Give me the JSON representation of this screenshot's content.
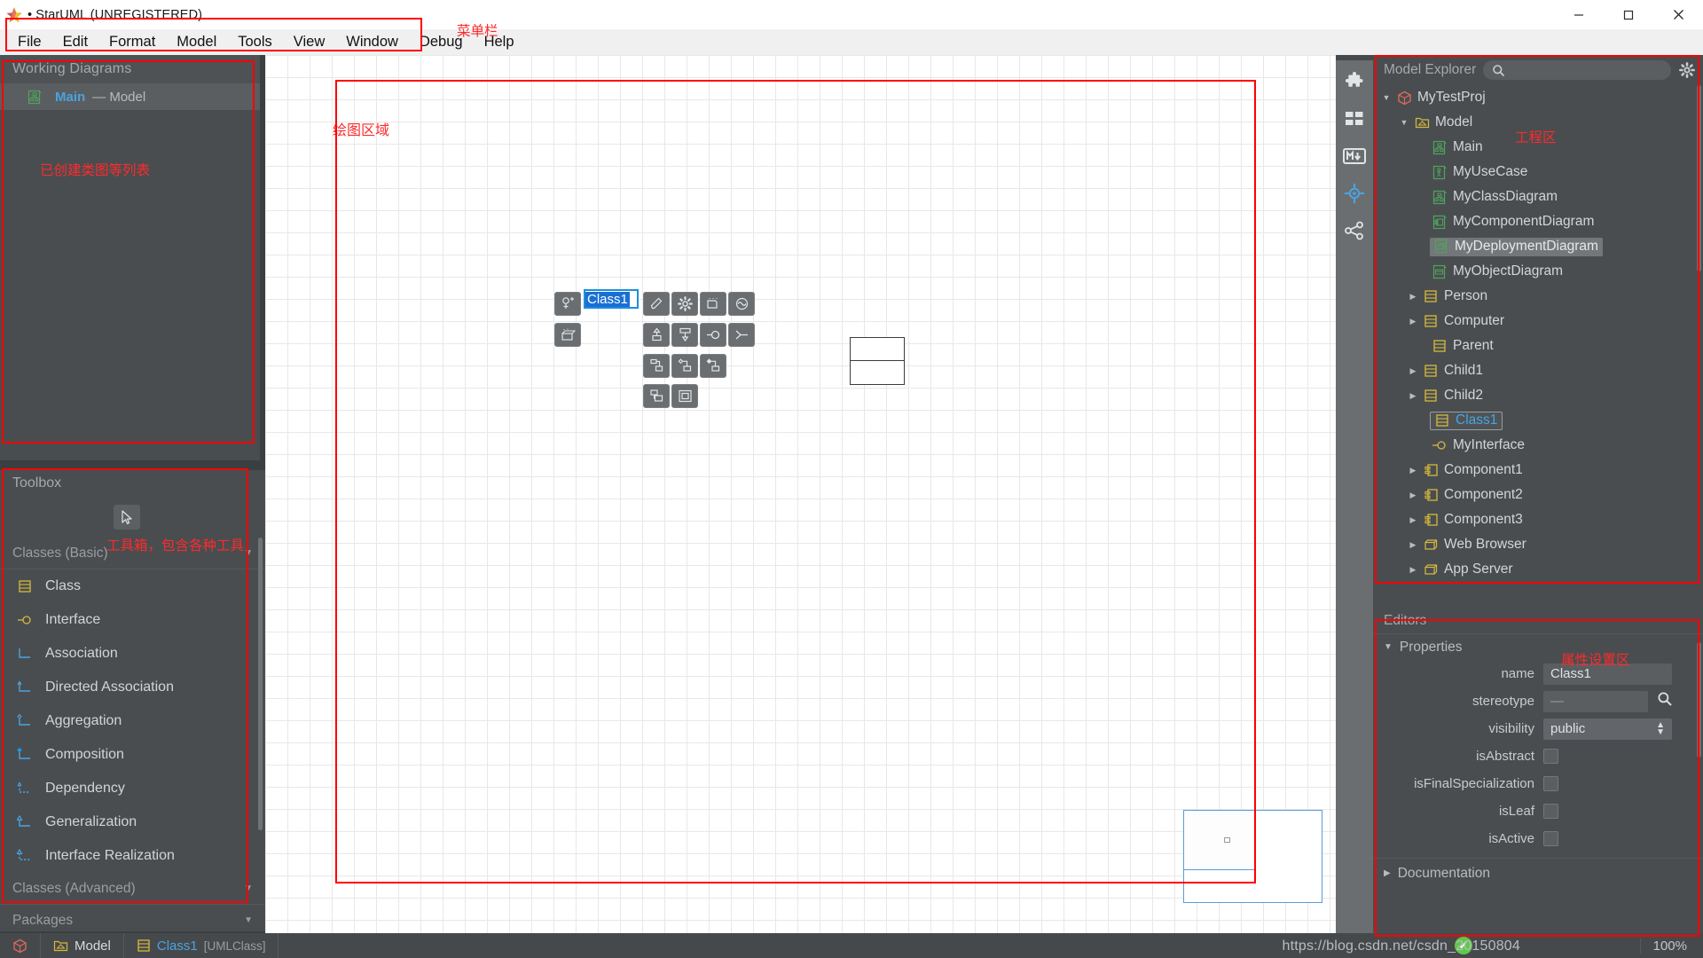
{
  "window": {
    "title": "• StarUML (UNREGISTERED)",
    "minimize_label": "–",
    "maximize_label": "□",
    "close_label": "✕"
  },
  "menubar": {
    "items": [
      "File",
      "Edit",
      "Format",
      "Model",
      "Tools",
      "View",
      "Window",
      "Debug",
      "Help"
    ],
    "annotation": "菜单栏"
  },
  "working_diagrams": {
    "title": "Working Diagrams",
    "annotation": "已创建类图等列表",
    "items": [
      {
        "name": "Main",
        "suffix": "— Model",
        "icon": "class-diagram-icon"
      }
    ]
  },
  "toolbox": {
    "title": "Toolbox",
    "annotation": "工具箱，包含各种工具",
    "cursor_tool": "select-pointer-icon",
    "sections": [
      {
        "label": "Classes (Basic)",
        "collapsed": false,
        "items": [
          {
            "label": "Class",
            "icon": "class-icon"
          },
          {
            "label": "Interface",
            "icon": "interface-icon"
          },
          {
            "label": "Association",
            "icon": "association-icon"
          },
          {
            "label": "Directed Association",
            "icon": "directed-association-icon"
          },
          {
            "label": "Aggregation",
            "icon": "aggregation-icon"
          },
          {
            "label": "Composition",
            "icon": "composition-icon"
          },
          {
            "label": "Dependency",
            "icon": "dependency-icon"
          },
          {
            "label": "Generalization",
            "icon": "generalization-icon"
          },
          {
            "label": "Interface Realization",
            "icon": "interface-realization-icon"
          }
        ]
      },
      {
        "label": "Classes (Advanced)",
        "collapsed": true,
        "items": []
      },
      {
        "label": "Packages",
        "collapsed": true,
        "items": []
      }
    ]
  },
  "canvas": {
    "annotation": "绘图区域",
    "class_shape": {
      "name": "Class1",
      "editing": true
    },
    "quick_edit": {
      "left_buttons": [
        {
          "name": "add-attribute-button",
          "icon": "attribute-plus-icon"
        },
        {
          "name": "add-operation-button",
          "icon": "operation-icon"
        }
      ],
      "right_buttons": [
        {
          "name": "style-button",
          "icon": "pencil-icon"
        },
        {
          "name": "properties-button",
          "icon": "gear-icon"
        },
        {
          "name": "add-note-button",
          "icon": "note-icon"
        },
        {
          "name": "add-state-button",
          "icon": "state-icon"
        },
        {
          "name": "generalization-button",
          "icon": "generalization-arrow-icon"
        },
        {
          "name": "realization-button",
          "icon": "realization-icon"
        },
        {
          "name": "interface-button",
          "icon": "lollipop-icon"
        },
        {
          "name": "dependency-button",
          "icon": "dependency-fork-icon"
        },
        {
          "name": "association-button",
          "icon": "association-line-icon"
        },
        {
          "name": "aggregation-button",
          "icon": "aggregation-diamond-icon"
        },
        {
          "name": "composition-button",
          "icon": "composition-diamond-icon"
        },
        {
          "name": "add-class-button",
          "icon": "class-box-icon"
        },
        {
          "name": "add-package-button",
          "icon": "package-box-icon"
        }
      ]
    }
  },
  "icon_rail": {
    "items": [
      {
        "name": "extensions-icon",
        "glyph": "puzzle"
      },
      {
        "name": "grid-layout-icon",
        "glyph": "grid"
      },
      {
        "name": "markdown-icon",
        "glyph": "MD"
      },
      {
        "name": "navigate-icon",
        "glyph": "target",
        "active": true
      },
      {
        "name": "relationships-icon",
        "glyph": "share"
      }
    ]
  },
  "model_explorer": {
    "title": "Model Explorer",
    "annotation": "工程区",
    "search_placeholder": "",
    "search_value": "",
    "tree": [
      {
        "label": "MyTestProj",
        "depth": 0,
        "icon": "project-icon",
        "twisty": "open",
        "state": "normal"
      },
      {
        "label": "Model",
        "depth": 1,
        "icon": "model-icon",
        "twisty": "open",
        "state": "normal"
      },
      {
        "label": "Main",
        "depth": 2,
        "icon": "class-diagram-icon",
        "twisty": "none",
        "state": "normal"
      },
      {
        "label": "MyUseCase",
        "depth": 2,
        "icon": "usecase-diagram-icon",
        "twisty": "none",
        "state": "normal"
      },
      {
        "label": "MyClassDiagram",
        "depth": 2,
        "icon": "class-diagram-icon",
        "twisty": "none",
        "state": "normal"
      },
      {
        "label": "MyComponentDiagram",
        "depth": 2,
        "icon": "component-diagram-icon",
        "twisty": "none",
        "state": "normal"
      },
      {
        "label": "MyDeploymentDiagram",
        "depth": 2,
        "icon": "deployment-diagram-icon",
        "twisty": "none",
        "state": "highlight"
      },
      {
        "label": "MyObjectDiagram",
        "depth": 2,
        "icon": "object-diagram-icon",
        "twisty": "none",
        "state": "normal"
      },
      {
        "label": "Person",
        "depth": 2,
        "icon": "class-icon",
        "twisty": "closed",
        "state": "normal"
      },
      {
        "label": "Computer",
        "depth": 2,
        "icon": "class-icon",
        "twisty": "closed",
        "state": "normal"
      },
      {
        "label": "Parent",
        "depth": 2,
        "icon": "class-icon",
        "twisty": "none",
        "state": "normal"
      },
      {
        "label": "Child1",
        "depth": 2,
        "icon": "class-icon",
        "twisty": "closed",
        "state": "normal"
      },
      {
        "label": "Child2",
        "depth": 2,
        "icon": "class-icon",
        "twisty": "closed",
        "state": "normal"
      },
      {
        "label": "Class1",
        "depth": 2,
        "icon": "class-icon",
        "twisty": "none",
        "state": "selected"
      },
      {
        "label": "MyInterface",
        "depth": 2,
        "icon": "interface-icon",
        "twisty": "none",
        "state": "normal"
      },
      {
        "label": "Component1",
        "depth": 2,
        "icon": "component-icon",
        "twisty": "closed",
        "state": "normal"
      },
      {
        "label": "Component2",
        "depth": 2,
        "icon": "component-icon",
        "twisty": "closed",
        "state": "normal"
      },
      {
        "label": "Component3",
        "depth": 2,
        "icon": "component-icon",
        "twisty": "closed",
        "state": "normal"
      },
      {
        "label": "Web Browser",
        "depth": 2,
        "icon": "node-icon",
        "twisty": "closed",
        "state": "normal"
      },
      {
        "label": "App Server",
        "depth": 2,
        "icon": "node-icon",
        "twisty": "closed",
        "state": "normal"
      }
    ]
  },
  "editors": {
    "title": "Editors",
    "annotation": "属性设置区",
    "properties_header": "Properties",
    "documentation_header": "Documentation",
    "rows": [
      {
        "label": "name",
        "type": "text",
        "value": "Class1"
      },
      {
        "label": "stereotype",
        "type": "text-search",
        "value": "—"
      },
      {
        "label": "visibility",
        "type": "select",
        "value": "public"
      },
      {
        "label": "isAbstract",
        "type": "checkbox",
        "value": false
      },
      {
        "label": "isFinalSpecialization",
        "type": "checkbox",
        "value": false
      },
      {
        "label": "isLeaf",
        "type": "checkbox",
        "value": false
      },
      {
        "label": "isActive",
        "type": "checkbox",
        "value": false
      }
    ]
  },
  "statusbar": {
    "project_icon": "project-icon",
    "cells": [
      {
        "label": "Model",
        "icon": "model-icon",
        "color": "#d8dadc"
      },
      {
        "label": "Class1",
        "icon": "class-icon",
        "color": "#4aa3e0",
        "suffix": "[UMLClass]"
      }
    ],
    "zoom": "100%",
    "watermark": "https://blog.csdn.net/csdn_20150804"
  },
  "colors": {
    "accent_blue": "#4aa3e0",
    "annotation_red": "#ff2a2a",
    "panel_bg": "#494d50",
    "yellow_icon": "#d6b93c",
    "green_icon": "#4fa35c"
  }
}
